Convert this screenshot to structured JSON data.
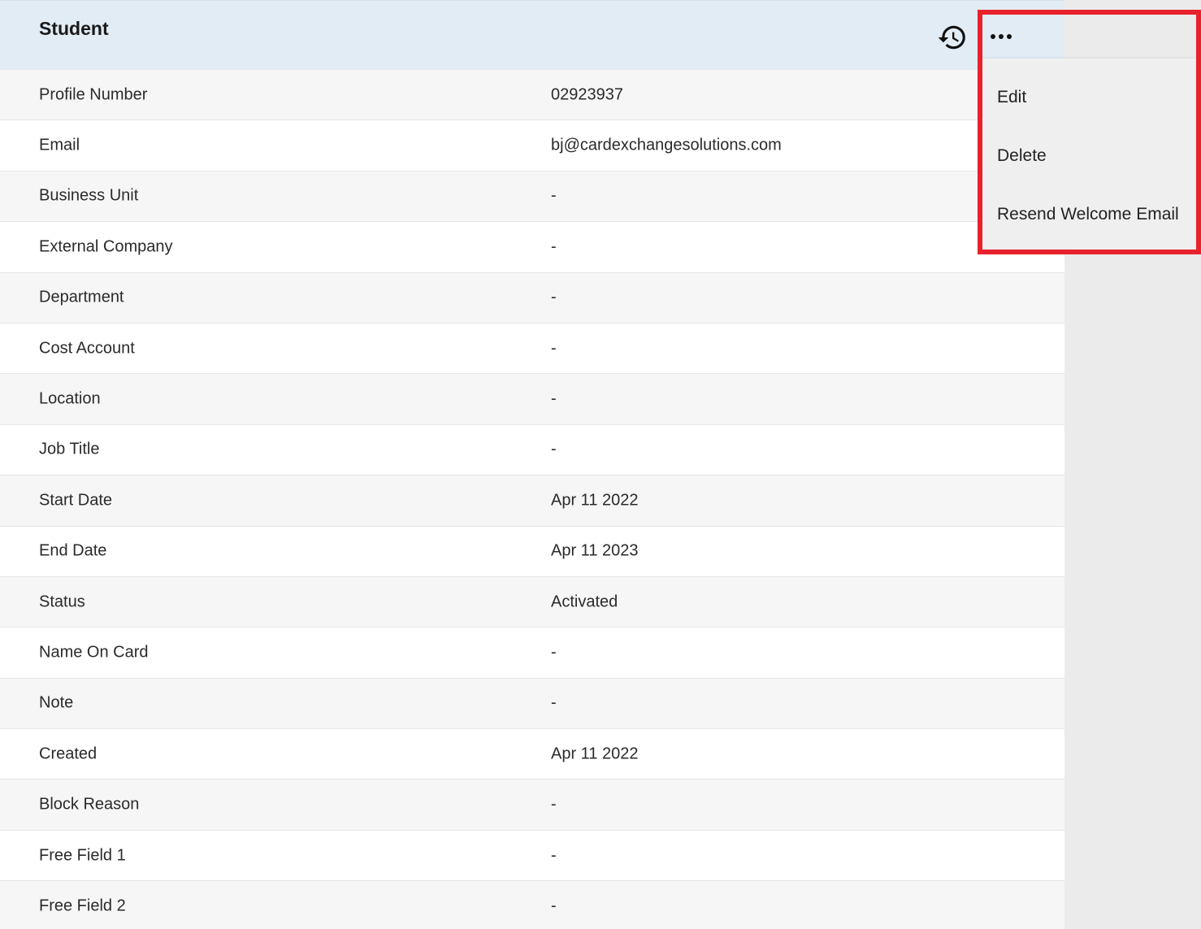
{
  "header": {
    "title": "Student",
    "history_icon": "history-icon",
    "more_icon": "more-horizontal-icon"
  },
  "menu": {
    "items": [
      {
        "label": "Edit"
      },
      {
        "label": "Delete"
      },
      {
        "label": "Resend Welcome Email"
      }
    ],
    "highlight_color": "#e8212d"
  },
  "details": {
    "rows": [
      {
        "label": "Profile Number",
        "value": "02923937"
      },
      {
        "label": "Email",
        "value": "bj@cardexchangesolutions.com"
      },
      {
        "label": "Business Unit",
        "value": "-"
      },
      {
        "label": "External Company",
        "value": "-"
      },
      {
        "label": "Department",
        "value": "-"
      },
      {
        "label": "Cost Account",
        "value": "-"
      },
      {
        "label": "Location",
        "value": "-"
      },
      {
        "label": "Job Title",
        "value": "-"
      },
      {
        "label": "Start Date",
        "value": "Apr 11 2022"
      },
      {
        "label": "End Date",
        "value": "Apr 11 2023"
      },
      {
        "label": "Status",
        "value": "Activated"
      },
      {
        "label": "Name On Card",
        "value": "-"
      },
      {
        "label": "Note",
        "value": "-"
      },
      {
        "label": "Created",
        "value": "Apr 11 2022"
      },
      {
        "label": "Block Reason",
        "value": "-"
      },
      {
        "label": "Free Field 1",
        "value": "-"
      },
      {
        "label": "Free Field 2",
        "value": "-"
      }
    ]
  },
  "colors": {
    "header_bg": "#e2ecf5",
    "row_alt_bg": "#f6f6f6",
    "page_bg": "#ebebeb"
  }
}
